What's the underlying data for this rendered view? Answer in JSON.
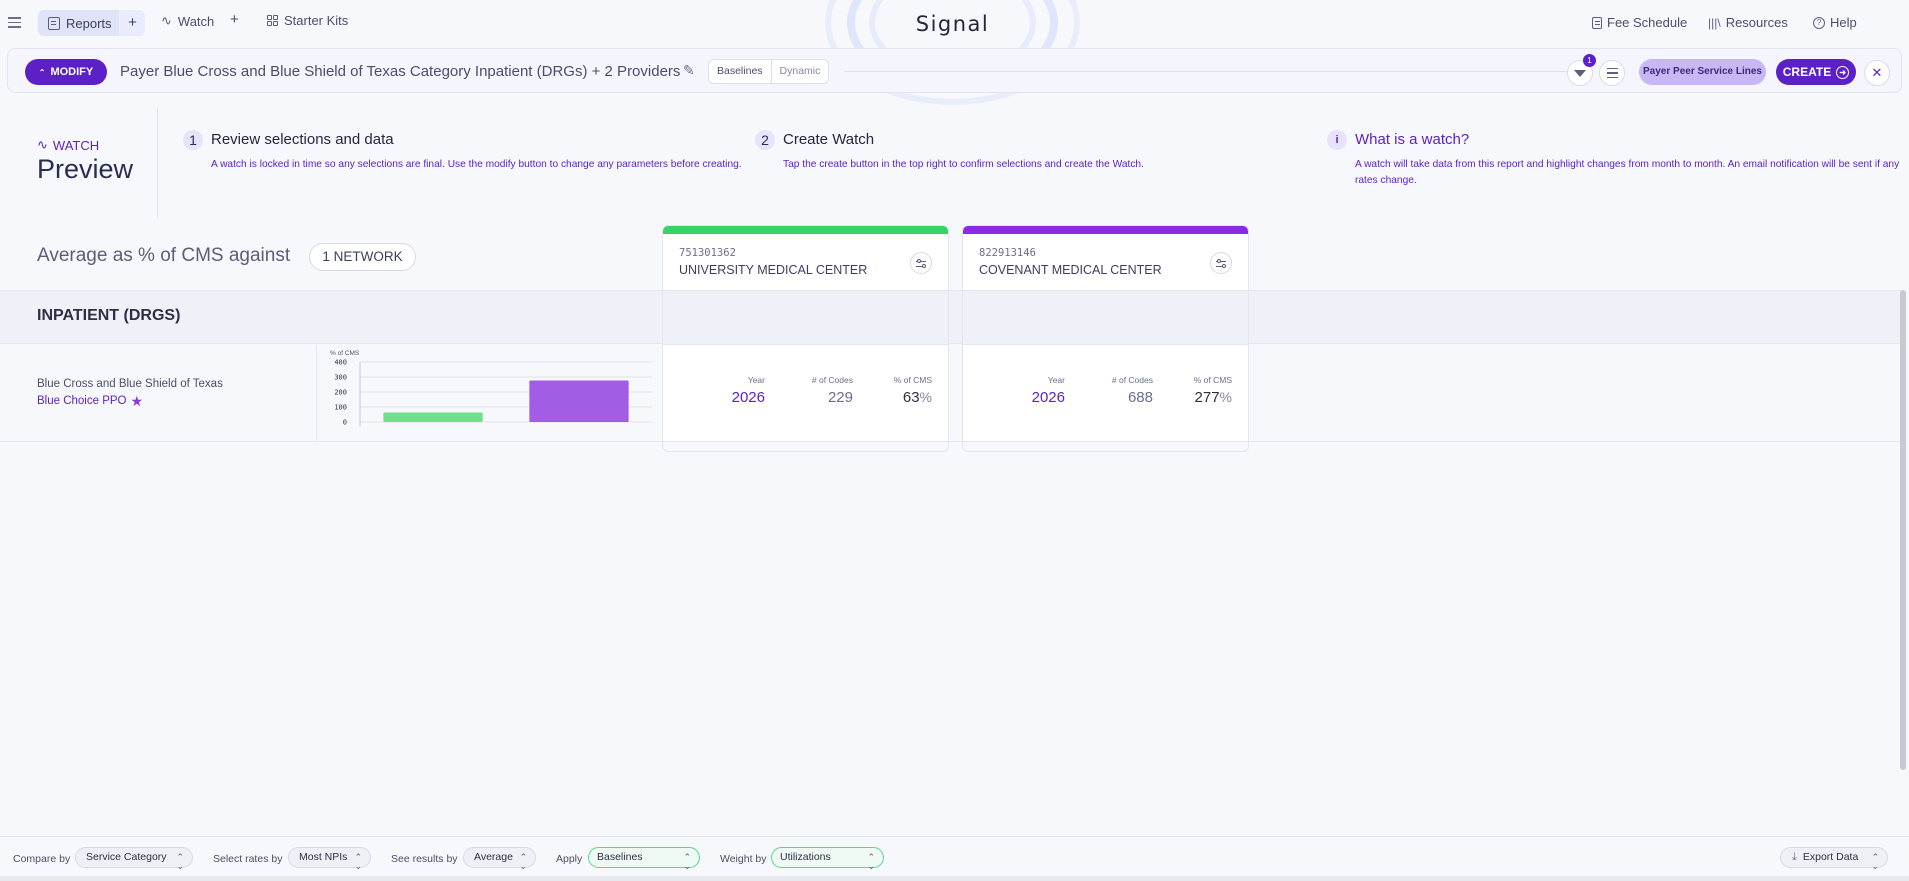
{
  "nav": {
    "reports_label": "Reports",
    "add_symbol": "+",
    "watch_label": "Watch",
    "starter_kits_label": "Starter Kits",
    "logo": "Signal",
    "fee_schedule_label": "Fee Schedule",
    "resources_label": "Resources",
    "help_label": "Help"
  },
  "report_bar": {
    "modify_label": "MODIFY",
    "title": "Payer Blue Cross and Blue Shield of Texas Category Inpatient (DRGs) + 2 Providers",
    "toggle": [
      "Baselines",
      "Dynamic"
    ],
    "filter_badge": "1",
    "peer_label": "Payer Peer Service Lines",
    "create_label": "CREATE"
  },
  "preview": {
    "watch_label": "WATCH",
    "title": "Preview",
    "steps": [
      {
        "num": "1",
        "head": "Review selections and data",
        "body": "A watch is locked in time so any selections are final. Use the modify button to change any parameters before creating."
      },
      {
        "num": "2",
        "head": "Create Watch",
        "body": "Tap the create button in the top right to confirm selections and create the Watch."
      },
      {
        "num": "i",
        "head": "What is a watch?",
        "body": "A watch will take data from this report and highlight changes from month to month. An email notification will be sent if any rates change."
      }
    ]
  },
  "table": {
    "avg_label": "Average as % of CMS against",
    "network_pill": "1 NETWORK",
    "category": "INPATIENT (DRGS)",
    "payer": "Blue Cross and Blue Shield of Texas",
    "plan": "Blue Choice PPO",
    "metric_labels": {
      "year": "Year",
      "codes": "# of Codes",
      "pct": "% of CMS"
    },
    "pct_unit": "%",
    "providers": [
      {
        "npi": "751301362",
        "name": "UNIVERSITY MEDICAL CENTER",
        "color": "#35d46a",
        "year": "2026",
        "codes": "229",
        "pct": "63"
      },
      {
        "npi": "822913146",
        "name": "COVENANT MEDICAL CENTER",
        "color": "#8a2be2",
        "year": "2026",
        "codes": "688",
        "pct": "277"
      }
    ]
  },
  "chart_data": {
    "type": "bar",
    "categories": [
      "UNIVERSITY MEDICAL CENTER",
      "COVENANT MEDICAL CENTER"
    ],
    "values": [
      63,
      277
    ],
    "colors": [
      "#6fe08b",
      "#a35ce6"
    ],
    "title": "",
    "ylabel": "% of CMS",
    "xlabel": "",
    "ylim": [
      0,
      400
    ],
    "yticks": [
      0,
      100,
      200,
      300,
      400
    ],
    "grid": true
  },
  "footer": {
    "compare_label": "Compare by",
    "compare_value": "Service Category",
    "rates_label": "Select rates by",
    "rates_value": "Most NPIs",
    "results_label": "See results by",
    "results_value": "Average",
    "apply_label": "Apply",
    "apply_value": "Baselines",
    "weight_label": "Weight by",
    "weight_value": "Utilizations",
    "export_label": "Export Data"
  }
}
